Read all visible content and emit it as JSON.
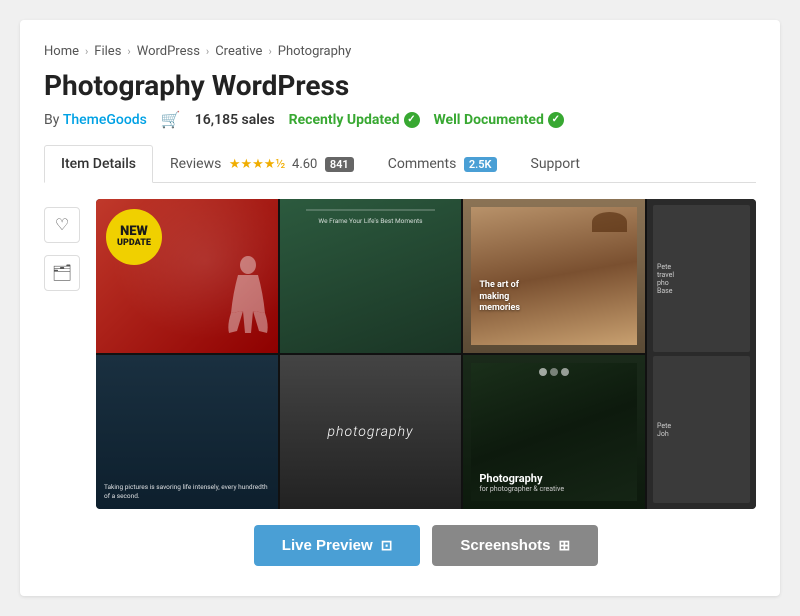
{
  "breadcrumb": {
    "items": [
      "Home",
      "Files",
      "WordPress",
      "Creative",
      "Photography"
    ]
  },
  "page": {
    "title": "Photography WordPress",
    "author_prefix": "By",
    "author_name": "ThemeGoods",
    "sales_count": "16,185 sales",
    "badge_recently": "Recently Updated",
    "badge_documented": "Well Documented"
  },
  "tabs": {
    "item_details": "Item Details",
    "reviews": "Reviews",
    "rating_value": "4.60",
    "review_count": "841",
    "comments": "Comments",
    "comment_count": "2.5K",
    "support": "Support"
  },
  "collage": {
    "new_badge_line1": "NEW",
    "new_badge_line2": "UPDATE",
    "cell2_text": "We Frame Your Life's Best Moments",
    "cell5_text": "Taking pictures is savoring life intensely, every hundredth of a second.",
    "photography_label": "photography",
    "bottom_text": "Photography",
    "bottom_sub": "for photographer & creative",
    "art_text": "The art of\nmaking\nmemories",
    "side_items": [
      "Pete\ntravel\npho\nBase",
      "Pete\nJoh"
    ]
  },
  "buttons": {
    "live_preview": "Live Preview",
    "screenshots": "Screenshots"
  },
  "icons": {
    "heart": "♡",
    "folder": "🗂",
    "cart": "🛒",
    "check": "✓",
    "monitor": "⊡",
    "image": "⊞",
    "star_full": "★",
    "star_half": "☆"
  }
}
